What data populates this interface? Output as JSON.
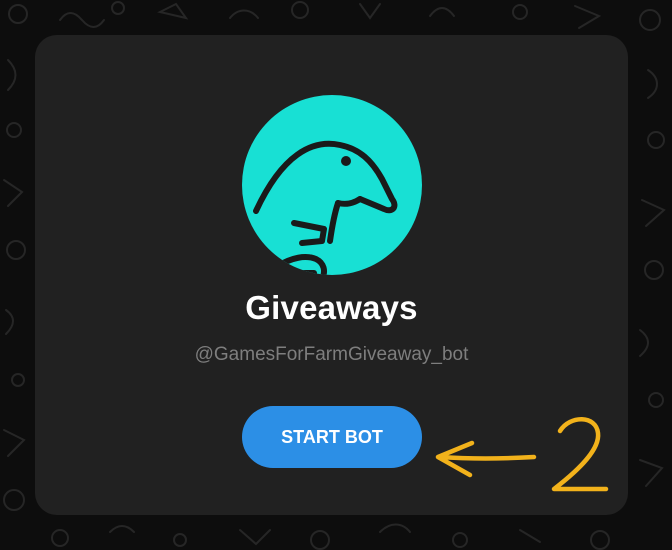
{
  "bot": {
    "name": "Giveaways",
    "username": "@GamesForFarmGiveaway_bot",
    "avatar_icon": "dinosaur-icon",
    "avatar_color": "#18e0d4"
  },
  "actions": {
    "start_label": "START BOT",
    "start_color": "#2c8fe6"
  },
  "annotation": {
    "marker": "arrow-icon",
    "number": "2",
    "color": "#f2b21b"
  }
}
